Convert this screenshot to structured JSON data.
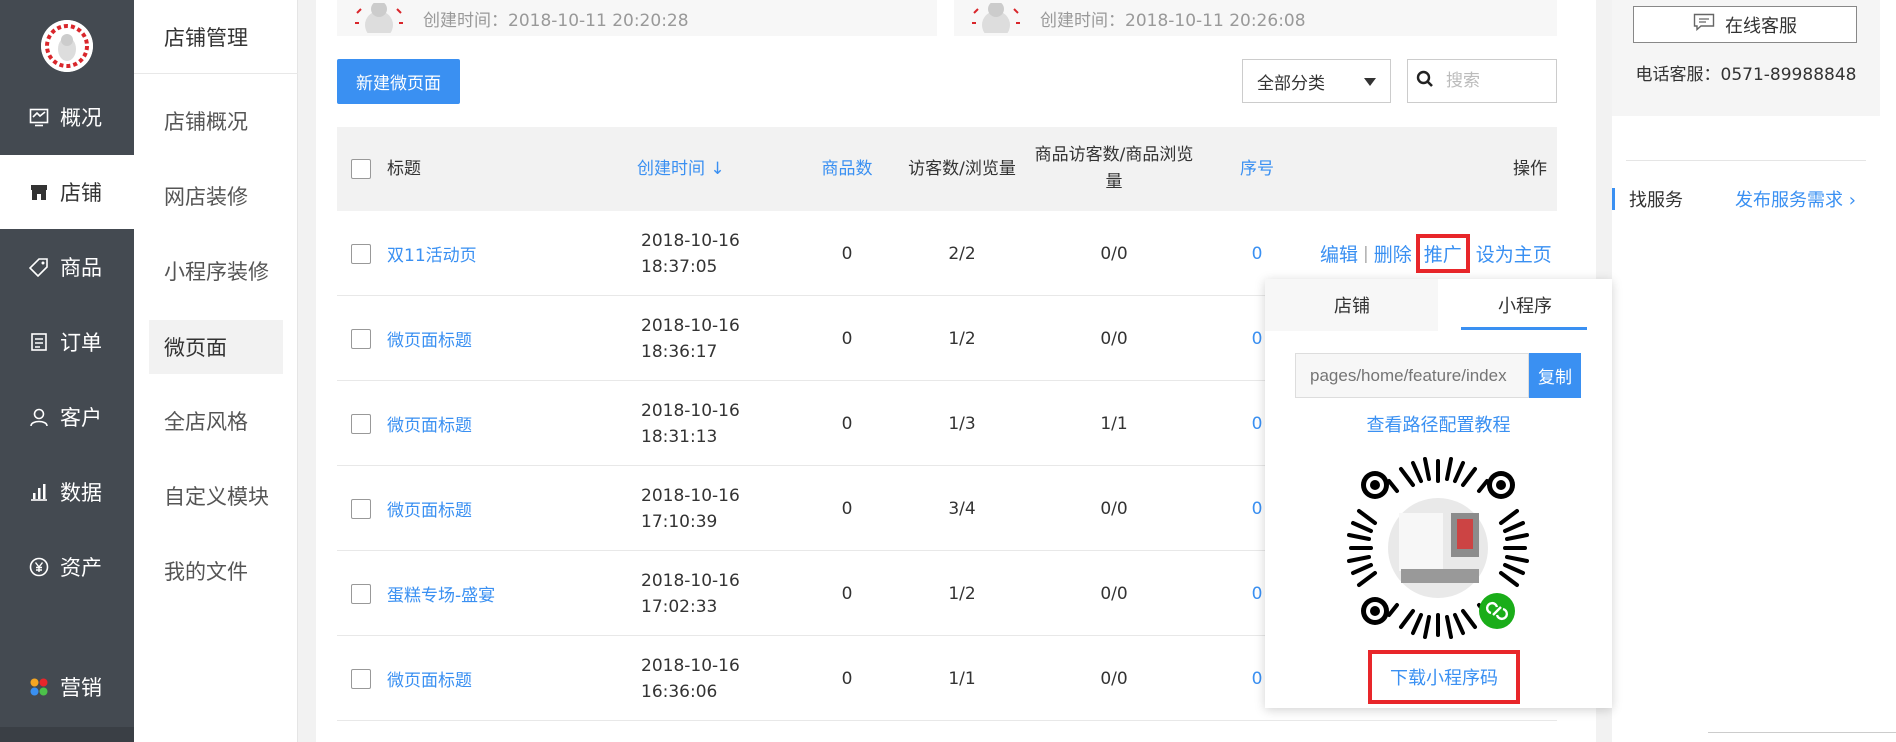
{
  "nav": {
    "items": [
      {
        "label": "概况",
        "icon": "overview-icon"
      },
      {
        "label": "店铺",
        "icon": "store-icon"
      },
      {
        "label": "商品",
        "icon": "tag-icon"
      },
      {
        "label": "订单",
        "icon": "order-icon"
      },
      {
        "label": "客户",
        "icon": "customer-icon"
      },
      {
        "label": "数据",
        "icon": "chart-icon"
      },
      {
        "label": "资产",
        "icon": "yen-icon"
      },
      {
        "label": "营销",
        "icon": "marketing-icon"
      }
    ]
  },
  "subnav": {
    "title": "店铺管理",
    "items": [
      "店铺概况",
      "网店装修",
      "小程序装修",
      "微页面",
      "全店风格",
      "自定义模块",
      "我的文件"
    ]
  },
  "top_cards": [
    {
      "created": "创建时间：2018-10-11 20:20:28"
    },
    {
      "created": "创建时间：2018-10-11 20:26:08"
    }
  ],
  "toolbar": {
    "new_label": "新建微页面",
    "category": "全部分类",
    "search_placeholder": "搜索"
  },
  "table": {
    "headers": {
      "title": "标题",
      "created": "创建时间 ↓",
      "goods": "商品数",
      "visitors": "访客数/浏览量",
      "goods_visitors": "商品访客数/商品浏览量",
      "order": "序号",
      "ops": "操作"
    },
    "rows": [
      {
        "title": "双11活动页",
        "date": "2018-10-16",
        "time": "18:37:05",
        "goods": "0",
        "visitors": "2/2",
        "goods_visitors": "0/0",
        "order": "0"
      },
      {
        "title": "微页面标题",
        "date": "2018-10-16",
        "time": "18:36:17",
        "goods": "0",
        "visitors": "1/2",
        "goods_visitors": "0/0",
        "order": "0"
      },
      {
        "title": "微页面标题",
        "date": "2018-10-16",
        "time": "18:31:13",
        "goods": "0",
        "visitors": "1/3",
        "goods_visitors": "1/1",
        "order": "0"
      },
      {
        "title": "微页面标题",
        "date": "2018-10-16",
        "time": "17:10:39",
        "goods": "0",
        "visitors": "3/4",
        "goods_visitors": "0/0",
        "order": "0"
      },
      {
        "title": "蛋糕专场-盛宴",
        "date": "2018-10-16",
        "time": "17:02:33",
        "goods": "0",
        "visitors": "1/2",
        "goods_visitors": "0/0",
        "order": "0"
      },
      {
        "title": "微页面标题",
        "date": "2018-10-16",
        "time": "16:36:06",
        "goods": "0",
        "visitors": "1/1",
        "goods_visitors": "0/0",
        "order": "0"
      }
    ],
    "ops": {
      "edit": "编辑",
      "delete": "删除",
      "promote": "推广",
      "set_home": "设为主页",
      "sep": "|"
    }
  },
  "service": {
    "online_label": "在线客服",
    "phone": "电话客服：0571-89988848",
    "find": "找服务",
    "post": "发布服务需求 ›"
  },
  "popup": {
    "tab_store": "店铺",
    "tab_mini": "小程序",
    "path_placeholder": "pages/home/feature/index",
    "copy_label": "复制",
    "tutorial": "查看路径配置教程",
    "download": "下载小程序码"
  },
  "colors": {
    "accent": "#3a90f2",
    "highlight": "#e8262a",
    "nav_bg": "#444a51"
  }
}
